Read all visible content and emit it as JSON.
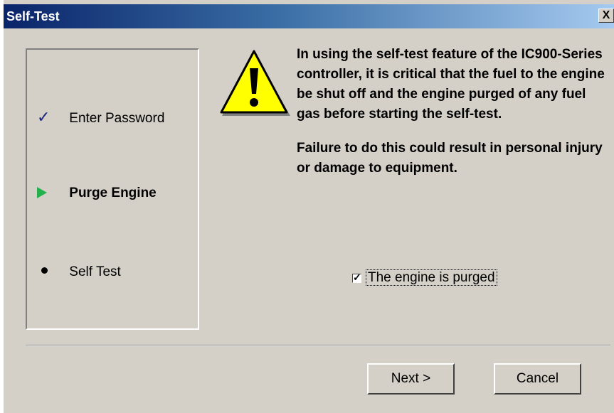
{
  "window": {
    "title": "Self-Test",
    "close_glyph": "X"
  },
  "steps": [
    {
      "label": "Enter Password",
      "state": "done",
      "icon": "checkmark-icon"
    },
    {
      "label": "Purge Engine",
      "state": "current",
      "icon": "green-arrow-icon"
    },
    {
      "label": "Self Test",
      "state": "pending",
      "icon": "bullet-icon"
    }
  ],
  "warning": {
    "icon": "warning-triangle-icon",
    "paragraph1": "In using the self-test feature of the IC900-Series controller, it is critical that the fuel to the engine be shut off and the engine purged of any fuel gas before starting the self-test.",
    "paragraph2": "Failure to do this could result in personal injury or damage to equipment."
  },
  "confirm": {
    "label": "The engine is purged",
    "checked": true
  },
  "buttons": {
    "next": "Next >",
    "cancel": "Cancel"
  },
  "colors": {
    "title_start": "#0a246a",
    "title_end": "#a6caf0",
    "face": "#d4d0c8",
    "arrow": "#22b14c",
    "warn_yellow": "#ffff00"
  }
}
